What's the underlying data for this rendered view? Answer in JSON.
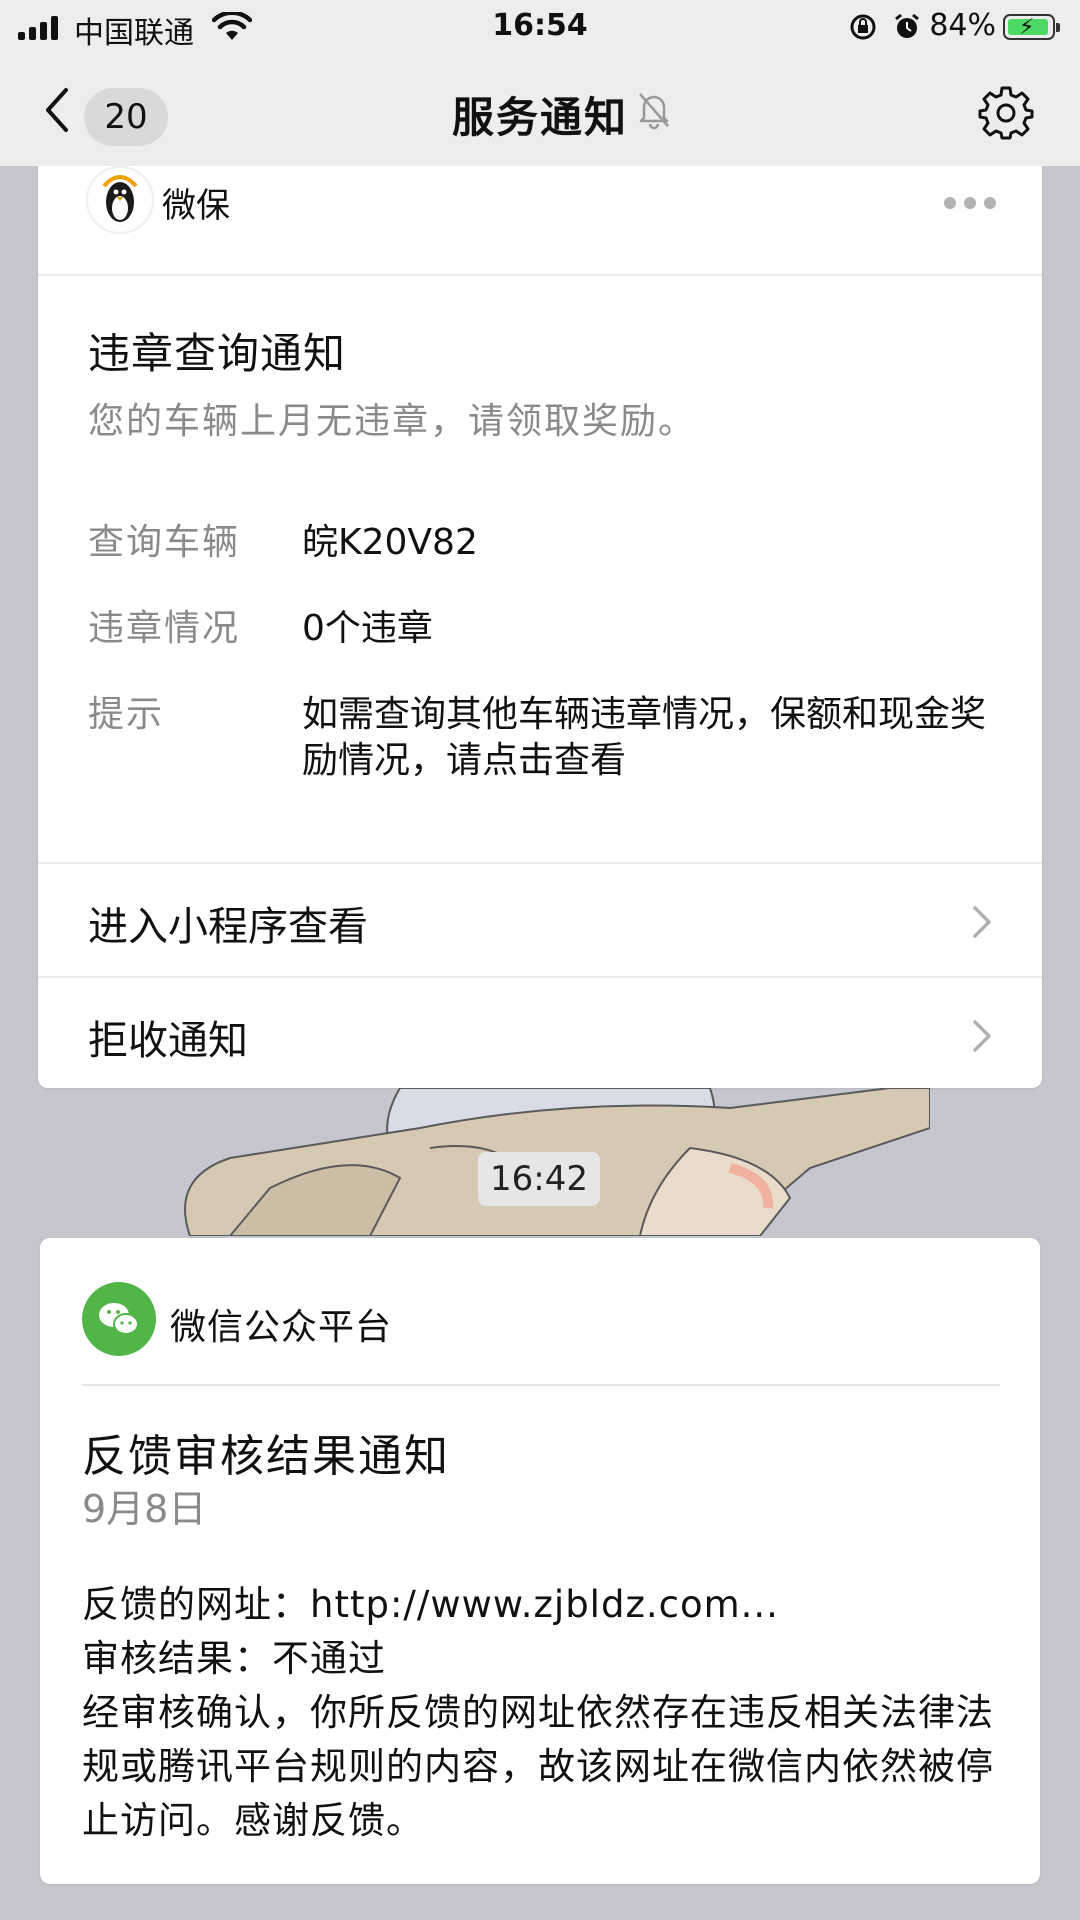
{
  "status_bar": {
    "carrier": "中国联通",
    "time": "16:54",
    "battery": "84%",
    "battery_level": 0.84
  },
  "nav": {
    "back_count": "20",
    "title": "服务通知"
  },
  "notice1": {
    "source": "微保",
    "title": "违章查询通知",
    "subtitle": "您的车辆上月无违章，请领取奖励。",
    "fields": [
      {
        "key": "查询车辆",
        "value": "皖K20V82"
      },
      {
        "key": "违章情况",
        "value": "0个违章"
      },
      {
        "key": "提示",
        "value": "如需查询其他车辆违章情况，保额和现金奖励情况，请点击查看"
      }
    ],
    "actions": [
      {
        "label": "进入小程序查看"
      },
      {
        "label": "拒收通知"
      }
    ]
  },
  "timestamp": "16:42",
  "notice2": {
    "source": "微信公众平台",
    "title": "反馈审核结果通知",
    "date": "9月8日",
    "lines": [
      "反馈的网址：http://www.zjbldz.com...",
      "审核结果：不通过",
      "经审核确认，你所反馈的网址依然存在违反相关法律法规或腾讯平台规则的内容，故该网址在微信内依然被停止访问。感谢反馈。"
    ]
  }
}
